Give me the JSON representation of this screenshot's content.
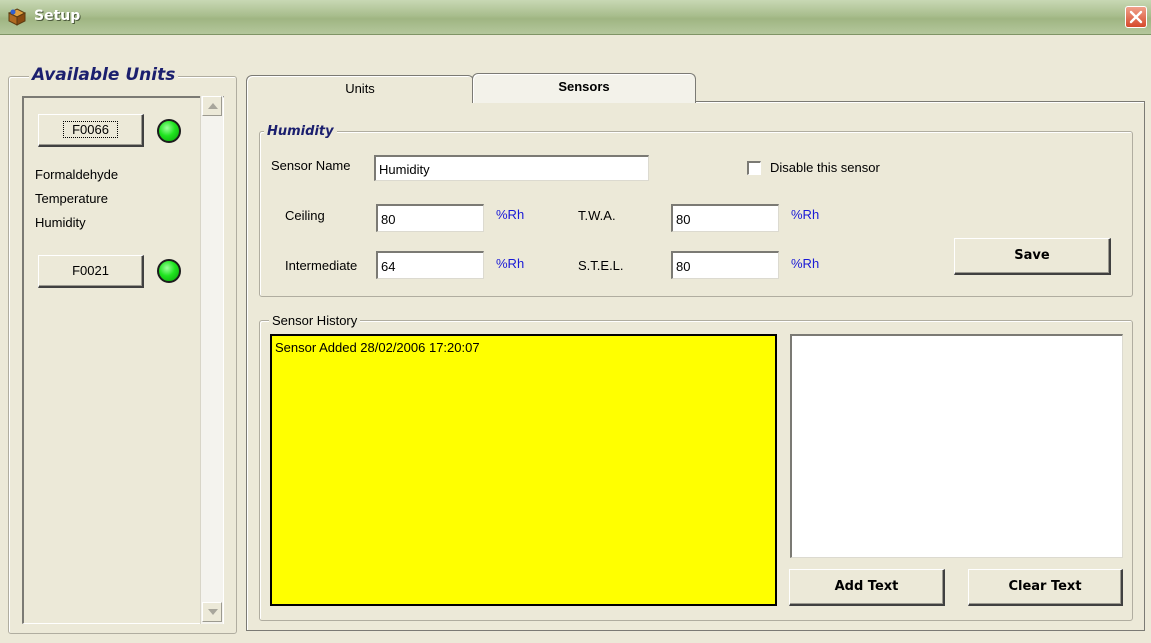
{
  "window": {
    "title": "Setup",
    "icon": "box-icon"
  },
  "available_units": {
    "title": "Available Units",
    "units": [
      {
        "id": "F0066",
        "status_color": "#1fe41f",
        "sensors": [
          "Formaldehyde",
          "Temperature",
          "Humidity"
        ]
      },
      {
        "id": "F0021",
        "status_color": "#1fe41f"
      }
    ]
  },
  "tabs": [
    {
      "label": "Units",
      "active": false
    },
    {
      "label": "Sensors",
      "active": true
    }
  ],
  "sensor": {
    "group_title": "Humidity",
    "name_label": "Sensor Name",
    "name_value": "Humidity",
    "disable_label": "Disable this sensor",
    "disabled": false,
    "ceiling_label": "Ceiling",
    "ceiling_value": "80",
    "ceiling_unit": "%Rh",
    "intermediate_label": "Intermediate",
    "intermediate_value": "64",
    "intermediate_unit": "%Rh",
    "twa_label": "T.W.A.",
    "twa_value": "80",
    "twa_unit": "%Rh",
    "stel_label": "S.T.E.L.",
    "stel_value": "80",
    "stel_unit": "%Rh",
    "save_label": "Save"
  },
  "history": {
    "title": "Sensor History",
    "entries": [
      "Sensor Added 28/02/2006 17:20:07"
    ],
    "notes_text": "",
    "add_label": "Add Text",
    "clear_label": "Clear Text",
    "log_color": "#ffff00"
  }
}
